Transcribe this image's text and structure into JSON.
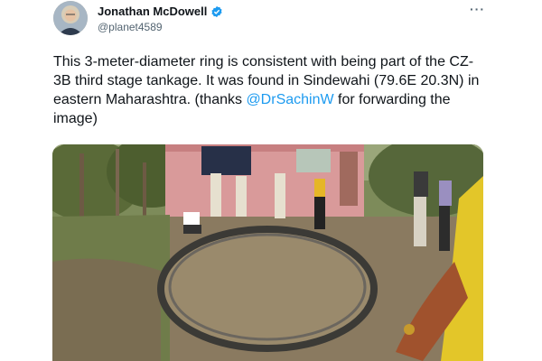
{
  "tweet": {
    "author_name": "Jonathan McDowell",
    "author_handle": "@planet4589",
    "more_icon": "more-horizontal-icon",
    "verified_icon": "verified-badge-icon",
    "text_part1": "This 3-meter-diameter ring is consistent with being part of the CZ-3B third stage tankage. It was found in Sindewahi (79.6E 20.3N) in eastern Maharashtra. (thanks ",
    "mention": "@DrSachinW",
    "text_part2": " for forwarding the image)",
    "more_symbol": "···"
  },
  "colors": {
    "link": "#1d9bf0",
    "verified": "#1d9bf0",
    "text": "#0f1419",
    "secondary": "#536471"
  }
}
